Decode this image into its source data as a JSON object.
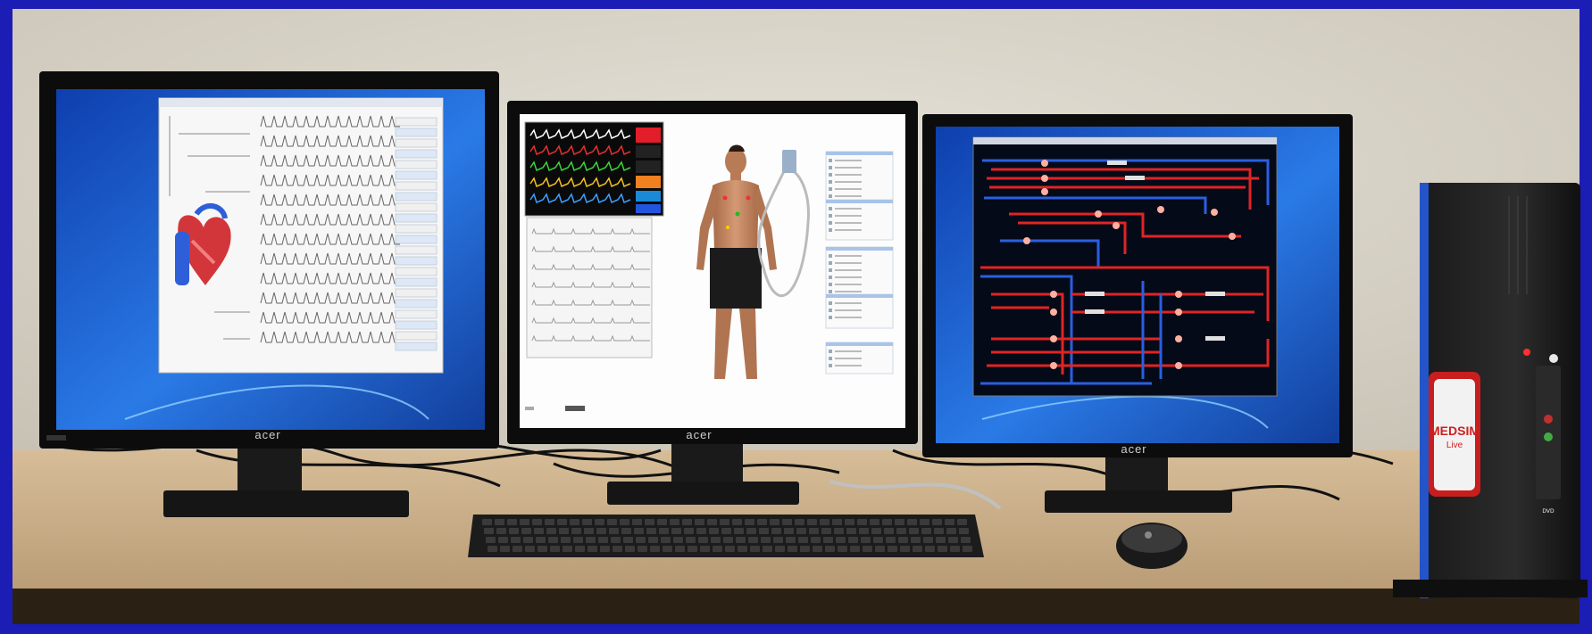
{
  "monitors": [
    {
      "brand": "acer",
      "app": "heart-schematic"
    },
    {
      "brand": "acer",
      "app": "patient-simulator"
    },
    {
      "brand": "acer",
      "app": "circulation-network"
    }
  ],
  "pc_label": {
    "line1": "MEDSIM",
    "line2": "Live"
  },
  "pc_drive_label": "DVD",
  "colors": {
    "frame": "#1b1db4",
    "wall": "#d9d4c8",
    "desk": "#cdb28d",
    "screen_blue": "#1f5fd6",
    "net_red": "#e02424",
    "net_blue": "#2a5fe0"
  }
}
